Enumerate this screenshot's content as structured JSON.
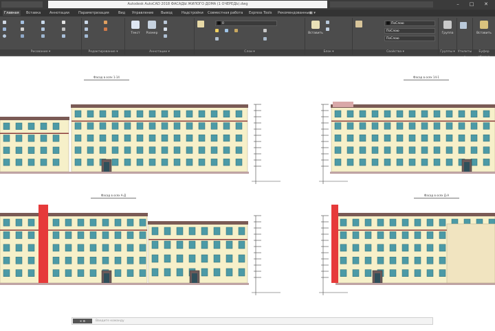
{
  "app": {
    "window_title": "Autodesk AutoCAD 2018   ФАСАДЫ ЖИЛОГО ДОМА (1 ОЧЕРЕДЬ).dwg",
    "window_controls": [
      "–",
      "□",
      "✕"
    ]
  },
  "menu_tabs": [
    "Главная",
    "Вставка",
    "Аннотации",
    "Параметризация",
    "Вид",
    "Управление",
    "Вывод",
    "Надстройки",
    "Совместная работа",
    "Express Tools",
    "Рекомендованные",
    "▣ ▾"
  ],
  "ribbon": {
    "panels": [
      {
        "title": "Рисование ▾"
      },
      {
        "title": "Редактирование ▾"
      },
      {
        "title": "Аннотации ▾"
      },
      {
        "title": "Слои ▾"
      },
      {
        "title": "Блок ▾"
      },
      {
        "title": "Свойства ▾"
      },
      {
        "title": "Группы ▾"
      },
      {
        "title": "Утилиты ▾"
      },
      {
        "title": "Буфер обмена"
      }
    ],
    "big_buttons": [
      {
        "label": "Текст",
        "color": "#dfe7f3"
      },
      {
        "label": "Размер",
        "color": "#c7d3e0"
      },
      {
        "label": "Вставить",
        "color": "#e9e1b8"
      },
      {
        "label": "Группа",
        "color": "#c9c9c9"
      },
      {
        "label": "Вставить",
        "color": "#d9c27e"
      }
    ],
    "layer_value": "0",
    "color_value": "ПоСлою",
    "linetype_value": "ПоСлою",
    "lineweight_value": "ПоСлою"
  },
  "drawing": {
    "elevations": [
      {
        "title": "Фасад в осях 1-14",
        "floors": 5
      },
      {
        "title": "Фасад в осях 14-1",
        "floors": 5
      },
      {
        "title": "Фасад в осях А-Д",
        "floors": 5
      },
      {
        "title": "Фасад в осях Д-А",
        "floors": 5
      }
    ],
    "colors": {
      "wall": "#f6f0c9",
      "window": "#4c9aa6",
      "roof": "#7a5a55",
      "band": "#8a3a3a",
      "accent_red": "#e63a3a",
      "ground": "#bfa3a3"
    }
  },
  "command_line": {
    "close_label": "✕ ⚙",
    "placeholder": "Введите команду"
  }
}
